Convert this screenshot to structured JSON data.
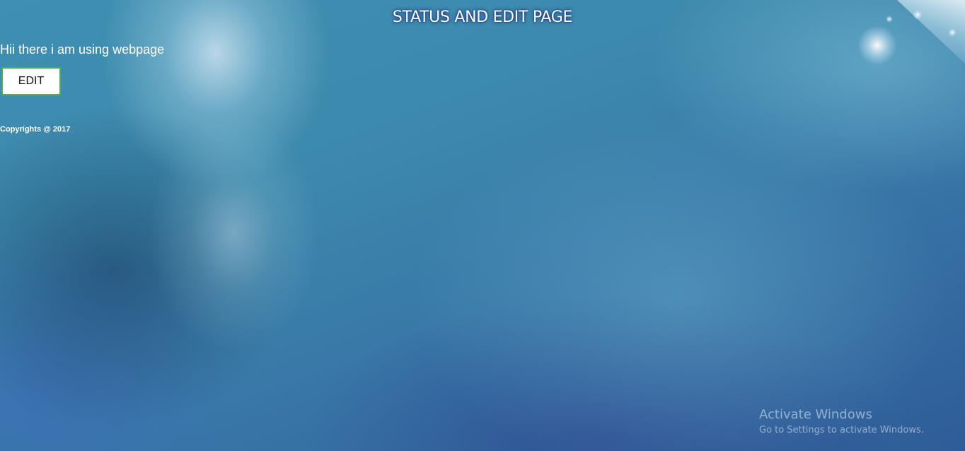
{
  "page": {
    "title": "STATUS AND EDIT PAGE",
    "status_text": "Hii there i am using webpage",
    "edit_label": "EDIT",
    "copyright": "Copyrights @ 2017"
  },
  "os_watermark": {
    "title": "Activate Windows",
    "subtitle": "Go to Settings to activate Windows."
  },
  "colors": {
    "button_border": "#4caf50",
    "background_primary": "#3c89ad",
    "title_shadow": "#141e78"
  }
}
